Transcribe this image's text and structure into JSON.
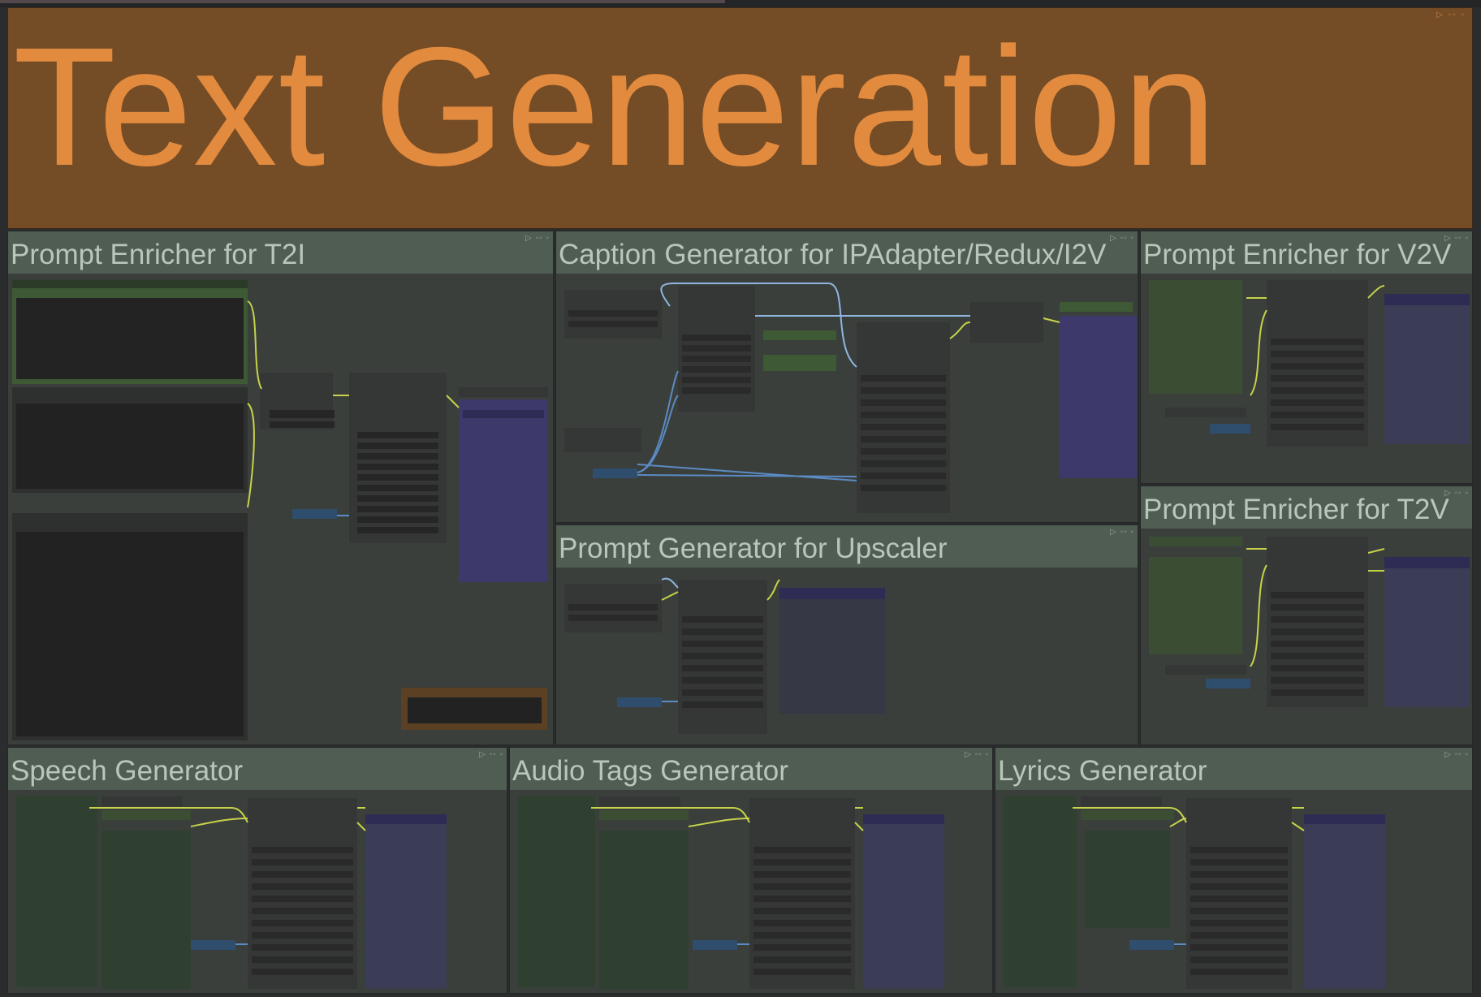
{
  "hero": {
    "title": "Text Generation",
    "controls": "▷ ◦◦ ◦"
  },
  "groups": [
    {
      "title": "Prompt Enricher for T2I",
      "controls": "▷ ◦◦ ◦"
    },
    {
      "title": "Caption Generator for IPAdapter/Redux/I2V",
      "controls": "▷ ◦◦ ◦"
    },
    {
      "title": "Prompt Enricher for V2V",
      "controls": "▷ ◦◦ ◦"
    },
    {
      "title": "Prompt Enricher for T2V",
      "controls": "▷ ◦◦ ◦"
    },
    {
      "title": "Prompt Generator for Upscaler",
      "controls": "▷ ◦◦ ◦"
    },
    {
      "title": "Speech Generator",
      "controls": "▷ ◦◦ ◦"
    },
    {
      "title": "Audio Tags Generator",
      "controls": "▷ ◦◦ ◦"
    },
    {
      "title": "Lyrics Generator",
      "controls": "▷ ◦◦ ◦"
    }
  ],
  "colors": {
    "hero_bg": "#744c26",
    "hero_text": "#e28a3d",
    "group_bg": "#3b3f3c",
    "group_header": "#505d52",
    "group_title": "#b9c6bb",
    "node": "#353636",
    "node_title": "#2c2d2d",
    "input_green": "#3e5a34",
    "output_purple": "#3d3a6b",
    "wire_yellow": "#c7d24a",
    "wire_blue": "#5b8bc4"
  }
}
